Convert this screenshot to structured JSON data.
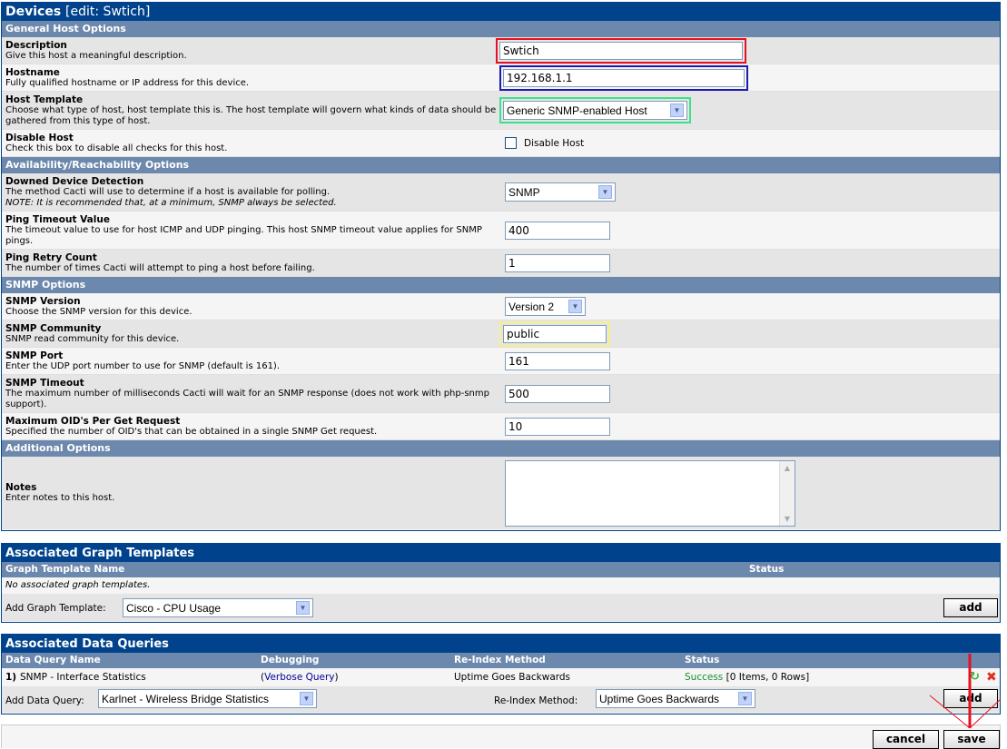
{
  "device": {
    "title": "Devices",
    "subtitle": "[edit: Swtich]",
    "sections": {
      "general": "General Host Options",
      "availability": "Availability/Reachability Options",
      "snmp": "SNMP Options",
      "additional": "Additional Options"
    },
    "fields": {
      "description": {
        "label": "Description",
        "help": "Give this host a meaningful description.",
        "value": "Swtich"
      },
      "hostname": {
        "label": "Hostname",
        "help": "Fully qualified hostname or IP address for this device.",
        "value": "192.168.1.1"
      },
      "host_template": {
        "label": "Host Template",
        "help": "Choose what type of host, host template this is. The host template will govern what kinds of data should be gathered from this type of host.",
        "value": "Generic SNMP-enabled Host"
      },
      "disable_host": {
        "label": "Disable Host",
        "help": "Check this box to disable all checks for this host.",
        "checkbox_label": "Disable Host"
      },
      "downed_detection": {
        "label": "Downed Device Detection",
        "help": "The method Cacti will use to determine if a host is available for polling.",
        "note": "NOTE: It is recommended that, at a minimum, SNMP always be selected.",
        "value": "SNMP"
      },
      "ping_timeout": {
        "label": "Ping Timeout Value",
        "help": "The timeout value to use for host ICMP and UDP pinging. This host SNMP timeout value applies for SNMP pings.",
        "value": "400"
      },
      "ping_retry": {
        "label": "Ping Retry Count",
        "help": "The number of times Cacti will attempt to ping a host before failing.",
        "value": "1"
      },
      "snmp_version": {
        "label": "SNMP Version",
        "help": "Choose the SNMP version for this device.",
        "value": "Version 2"
      },
      "snmp_community": {
        "label": "SNMP Community",
        "help": "SNMP read community for this device.",
        "value": "public"
      },
      "snmp_port": {
        "label": "SNMP Port",
        "help": "Enter the UDP port number to use for SNMP (default is 161).",
        "value": "161"
      },
      "snmp_timeout": {
        "label": "SNMP Timeout",
        "help": "The maximum number of milliseconds Cacti will wait for an SNMP response (does not work with php-snmp support).",
        "value": "500"
      },
      "max_oids": {
        "label": "Maximum OID's Per Get Request",
        "help": "Specified the number of OID's that can be obtained in a single SNMP Get request.",
        "value": "10"
      },
      "notes": {
        "label": "Notes",
        "help": "Enter notes to this host.",
        "value": ""
      }
    }
  },
  "graph_templates": {
    "title": "Associated Graph Templates",
    "col_name": "Graph Template Name",
    "col_status": "Status",
    "empty": "No associated graph templates.",
    "add_label": "Add Graph Template:",
    "add_value": "Cisco - CPU Usage",
    "add_button": "add"
  },
  "data_queries": {
    "title": "Associated Data Queries",
    "cols": {
      "name": "Data Query Name",
      "debug": "Debugging",
      "reindex": "Re-Index Method",
      "status": "Status"
    },
    "row": {
      "index": "1)",
      "name": "SNMP - Interface Statistics",
      "debug_open": "(",
      "debug_link": "Verbose Query",
      "debug_close": ")",
      "reindex": "Uptime Goes Backwards",
      "status_ok": "Success",
      "status_rest": "[0 Items, 0 Rows]"
    },
    "add_label": "Add Data Query:",
    "add_value": "Karlnet - Wireless Bridge Statistics",
    "reindex_label": "Re-Index Method:",
    "reindex_value": "Uptime Goes Backwards",
    "add_button": "add"
  },
  "footer": {
    "cancel": "cancel",
    "save": "save"
  },
  "colors": {
    "header": "#00438C",
    "section": "#6D88AD",
    "highlight_red": "#E8101E",
    "highlight_blue": "#1B1AB0",
    "highlight_green": "#3AE38A",
    "highlight_yellow": "#F5F08A"
  }
}
